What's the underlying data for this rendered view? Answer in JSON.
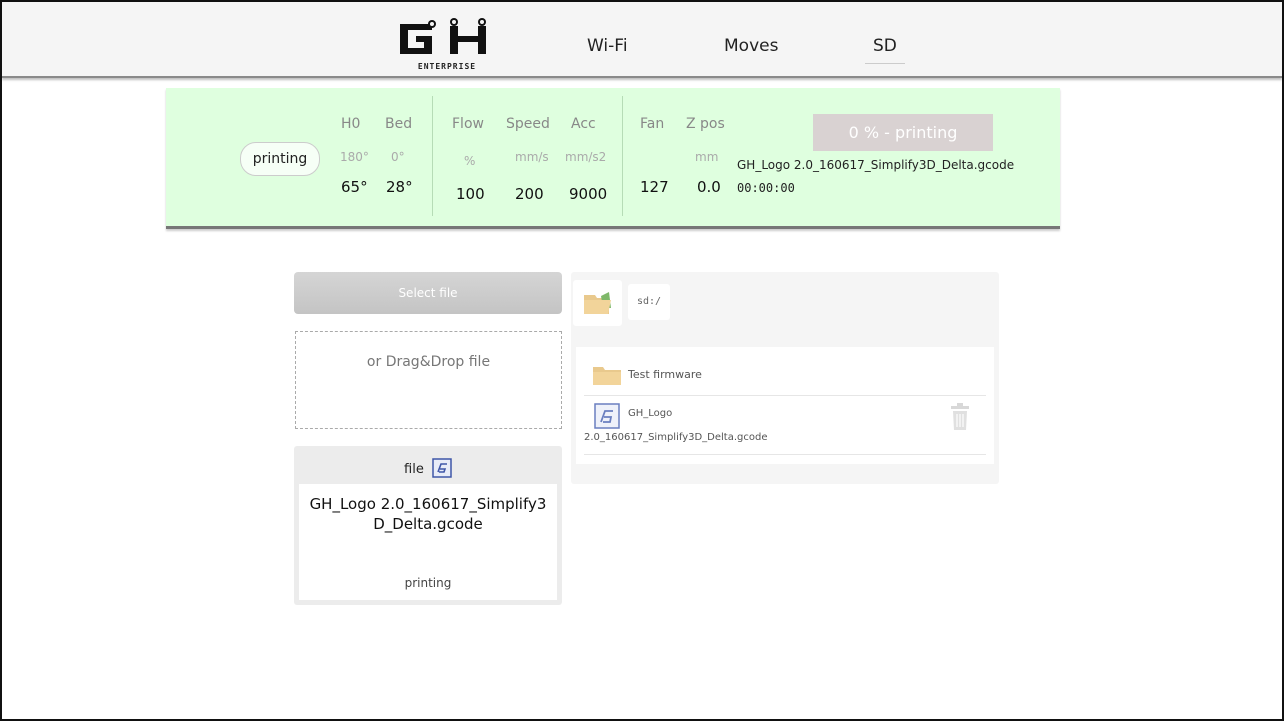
{
  "header": {
    "logo_text": "GH",
    "logo_subtitle": "ENTERPRISE",
    "nav": [
      {
        "label": "Wi-Fi"
      },
      {
        "label": "Moves"
      },
      {
        "label": "SD"
      }
    ]
  },
  "status": {
    "state": "printing",
    "columns": [
      {
        "header": "H0",
        "target": "180°",
        "value": "65°"
      },
      {
        "header": "Bed",
        "target": "0°",
        "value": "28°"
      },
      {
        "header": "Flow",
        "unit": "%",
        "value": "100"
      },
      {
        "header": "Speed",
        "unit": "mm/s",
        "value": "200"
      },
      {
        "header": "Acc",
        "unit": "mm/s2",
        "value": "9000"
      },
      {
        "header": "Fan",
        "unit": "",
        "value": "127"
      },
      {
        "header": "Z pos",
        "unit": "mm",
        "value": "0.0"
      }
    ],
    "progress_label": "0 % - printing",
    "progress_percent": 0,
    "file_name": "GH_Logo 2.0_160617_Simplify3D_Delta.gcode",
    "elapsed": "00:00:00"
  },
  "upload": {
    "select_label": "Select file",
    "drop_label": "or Drag&Drop file",
    "card_title": "file",
    "card_filename": "GH_Logo 2.0_160617_Simplify3D_Delta.gcode",
    "card_state": "printing"
  },
  "browser": {
    "path": "sd:/",
    "items": [
      {
        "name": "Test firmware",
        "type": "folder"
      },
      {
        "name_line1": "GH_Logo",
        "name_line2": "2.0_160617_Simplify3D_Delta.gcode",
        "type": "gcode"
      }
    ]
  },
  "colors": {
    "status_bg": "#dfffdf",
    "progress_bg": "#d9d2d2",
    "folder": "#f2d49a",
    "file_icon": "#3f56a8"
  }
}
